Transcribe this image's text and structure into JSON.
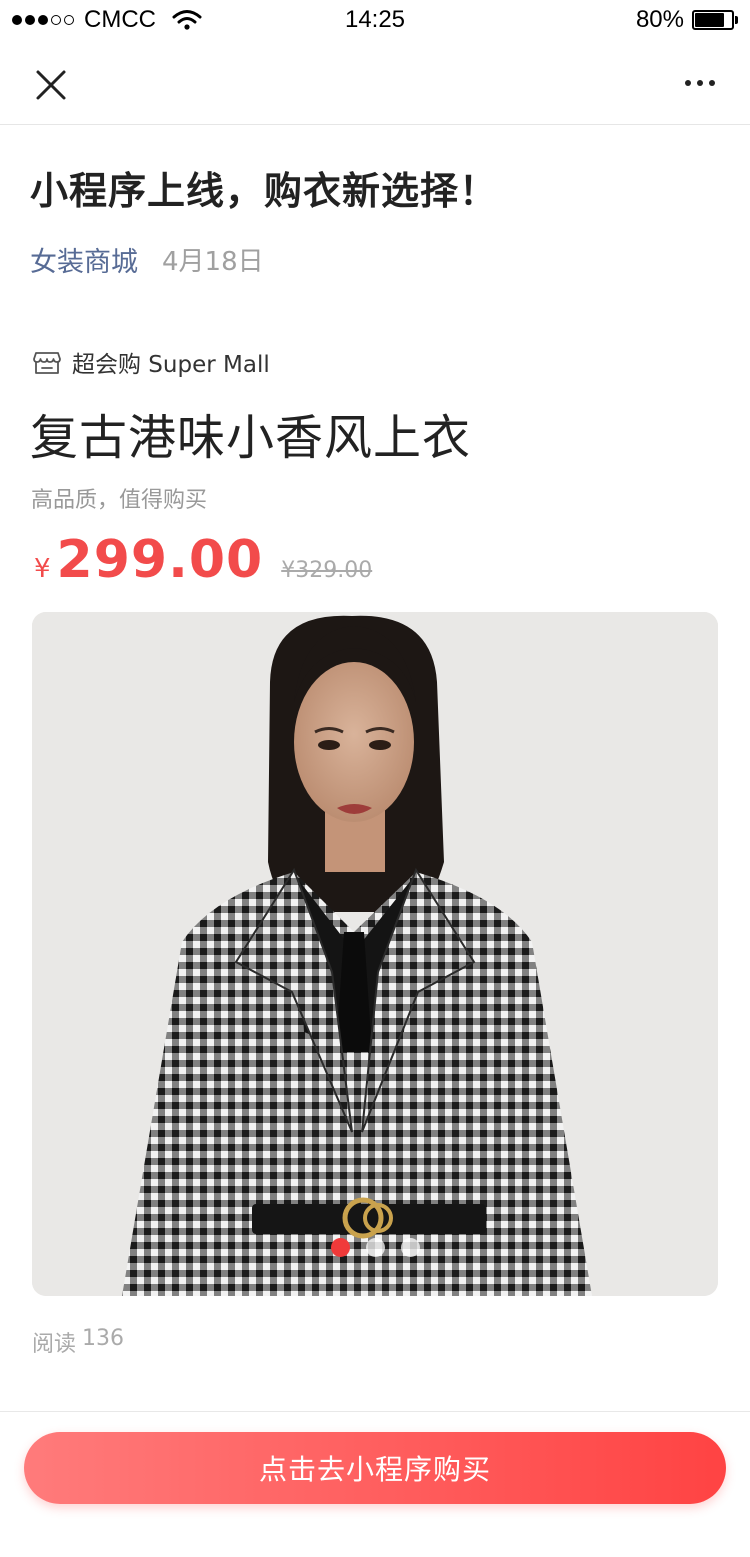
{
  "status_bar": {
    "carrier": "CMCC",
    "time": "14:25",
    "battery_percent": "80%",
    "battery_level": 0.8,
    "signal_icon": "signal-dots-icon",
    "wifi_icon": "wifi-icon",
    "battery_icon": "battery-icon"
  },
  "nav": {
    "close_icon": "close-icon",
    "more_icon": "more-dots-icon"
  },
  "article": {
    "title": "小程序上线，购衣新选择！",
    "account": "女装商城",
    "date": "4月18日"
  },
  "product": {
    "shop_icon": "store-icon",
    "shop_name": "超会购 Super Mall",
    "name": "复古港味小香风上衣",
    "subtitle": "高品质，值得购买",
    "currency": "¥",
    "price": "299.00",
    "original_price": "¥329.00",
    "image_count": 3,
    "active_image": 1
  },
  "stats": {
    "read_label": "阅读",
    "read_count": "136"
  },
  "footer": {
    "buy_label": "点击去小程序购买"
  },
  "colors": {
    "accent": "#f24b4b",
    "link": "#576b95",
    "button_start": "#ff7b7b",
    "button_end": "#ff4343"
  }
}
